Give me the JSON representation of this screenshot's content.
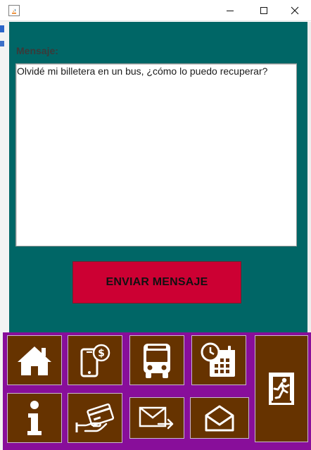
{
  "window": {
    "icon": "java-app-icon",
    "controls": [
      "minimize-icon",
      "maximize-icon",
      "close-icon"
    ]
  },
  "form": {
    "message_label": "Mensaje:",
    "message_value": "Olvidé mi billetera en un bus, ¿cómo lo puedo recuperar?",
    "send_button_label": "ENVIAR MENSAJE"
  },
  "navigation": {
    "tiles": [
      {
        "icon": "home-icon"
      },
      {
        "icon": "mobile-payment-icon"
      },
      {
        "icon": "bus-icon"
      },
      {
        "icon": "schedule-calendar-icon"
      },
      {
        "icon": "exit-icon"
      },
      {
        "icon": "info-icon"
      },
      {
        "icon": "card-payment-icon"
      },
      {
        "icon": "send-mail-icon"
      },
      {
        "icon": "open-mail-icon"
      }
    ]
  },
  "colors": {
    "content_background": "#006666",
    "send_button": "#cc0033",
    "nav_panel": "#880e9a",
    "nav_tile": "#663300",
    "icon_color": "#ffffff"
  }
}
